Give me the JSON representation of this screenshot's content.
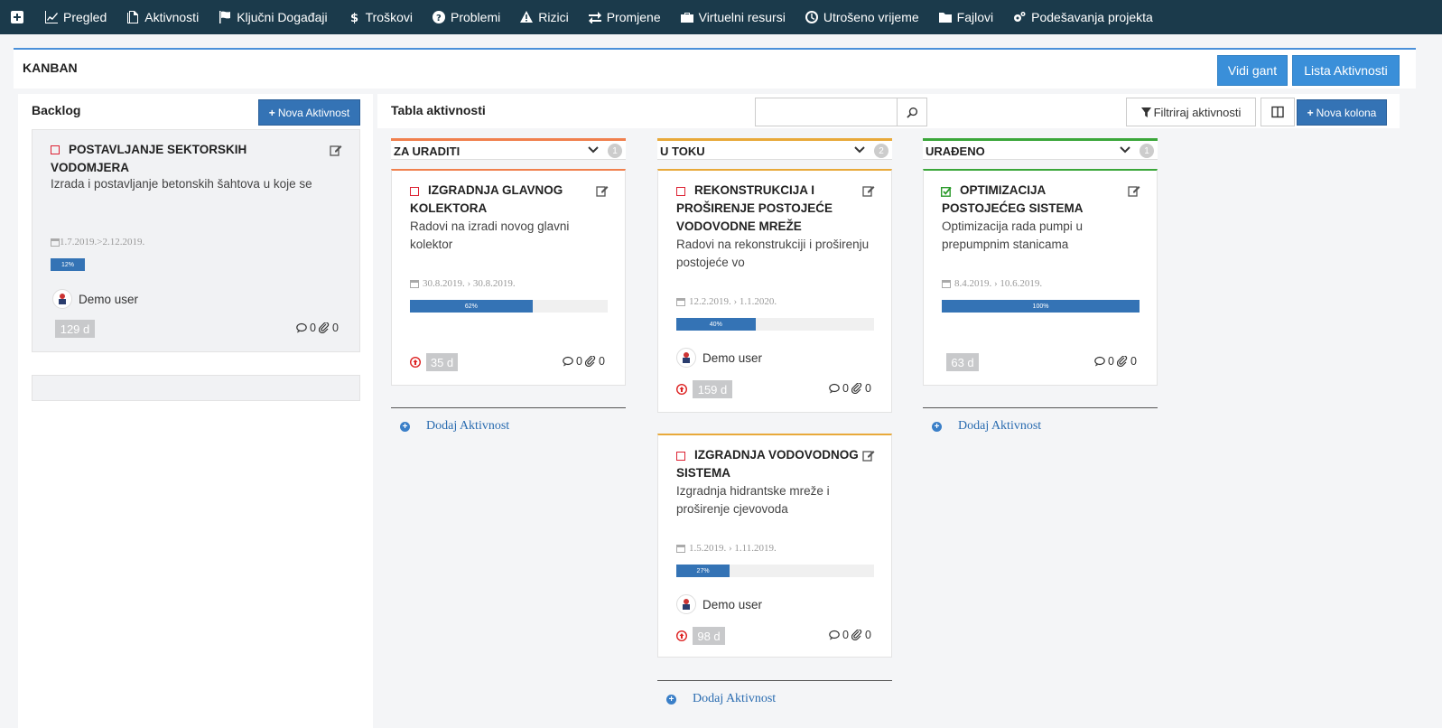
{
  "nav": {
    "items": [
      {
        "label": "Pregled",
        "icon": "chart-line-icon"
      },
      {
        "label": "Aktivnosti",
        "icon": "files-icon"
      },
      {
        "label": "Ključni Događaji",
        "icon": "flag-icon"
      },
      {
        "label": "Troškovi",
        "icon": "dollar-icon"
      },
      {
        "label": "Problemi",
        "icon": "question-circle-icon"
      },
      {
        "label": "Rizici",
        "icon": "warning-icon"
      },
      {
        "label": "Promjene",
        "icon": "exchange-icon"
      },
      {
        "label": "Virtuelni resursi",
        "icon": "briefcase-icon"
      },
      {
        "label": "Utrošeno vrijeme",
        "icon": "clock-icon"
      },
      {
        "label": "Fajlovi",
        "icon": "folder-icon"
      },
      {
        "label": "Podešavanja projekta",
        "icon": "cogs-icon"
      }
    ]
  },
  "header": {
    "title": "KANBAN",
    "gantt_button": "Vidi gant",
    "list_button": "Lista Aktivnosti"
  },
  "backlog": {
    "title": "Backlog",
    "new_button": "Nova Aktivnost",
    "card": {
      "title_line1": "POSTAVLJANJE SEKTORSKIH",
      "title_line2": "VODOMJERA",
      "description": "Izrada i postavljanje betonskih šahtova u koje se",
      "dates": "1.7.2019.>2.12.2019.",
      "progress": 12,
      "progress_label": "12%",
      "user": "Demo user",
      "days": "129 d",
      "comments": "0",
      "attachments": "0"
    }
  },
  "board": {
    "title": "Tabla aktivnosti",
    "search_placeholder": "",
    "filter_button": "Filtriraj aktivnosti",
    "new_column_button": "Nova kolona",
    "add_activity": "Dodaj Aktivnost",
    "columns": [
      {
        "name": "ZA URADITI",
        "count": "1",
        "color": "#f0804e",
        "cards": [
          {
            "title_lines": [
              "IZGRADNJA GLAVNOG",
              "KOLEKTORA"
            ],
            "desc_lines": [
              "Radovi na izradi novog glavni",
              "kolektor"
            ],
            "dates": "30.8.2019. › 30.8.2019.",
            "progress": 62,
            "progress_label": "62%",
            "user": "",
            "days": "35 d",
            "comments": "0",
            "attachments": "0",
            "done": false
          }
        ]
      },
      {
        "name": "U TOKU",
        "count": "2",
        "color": "#e8a93a",
        "cards": [
          {
            "title_lines": [
              "REKONSTRUKCIJA I",
              "PROŠIRENJE POSTOJEĆE",
              "VODOVODNE MREŽE"
            ],
            "desc_lines": [
              "Radovi na rekonstrukciji i proširenju",
              "postojeće vo"
            ],
            "dates": "12.2.2019. › 1.1.2020.",
            "progress": 40,
            "progress_label": "40%",
            "user": "Demo user",
            "days": "159 d",
            "comments": "0",
            "attachments": "0",
            "done": false
          },
          {
            "title_lines": [
              "IZGRADNJA VODOVODNOG",
              "SISTEMA"
            ],
            "desc_lines": [
              "Izgradnja hidrantske mreže i",
              "proširenje cjevovoda"
            ],
            "dates": "1.5.2019. › 1.11.2019.",
            "progress": 27,
            "progress_label": "27%",
            "user": "Demo user",
            "days": "98 d",
            "comments": "0",
            "attachments": "0",
            "done": false
          }
        ]
      },
      {
        "name": "URAĐENO",
        "count": "1",
        "color": "#3aa63a",
        "cards": [
          {
            "title_lines": [
              "OPTIMIZACIJA",
              "POSTOJEĆEG SISTEMA"
            ],
            "desc_lines": [
              "Optimizacija rada pumpi u",
              "prepumpnim stanicama"
            ],
            "dates": "8.4.2019. › 10.6.2019.",
            "progress": 100,
            "progress_label": "100%",
            "user": "",
            "days": "63 d",
            "comments": "0",
            "attachments": "0",
            "done": true
          }
        ]
      }
    ]
  }
}
